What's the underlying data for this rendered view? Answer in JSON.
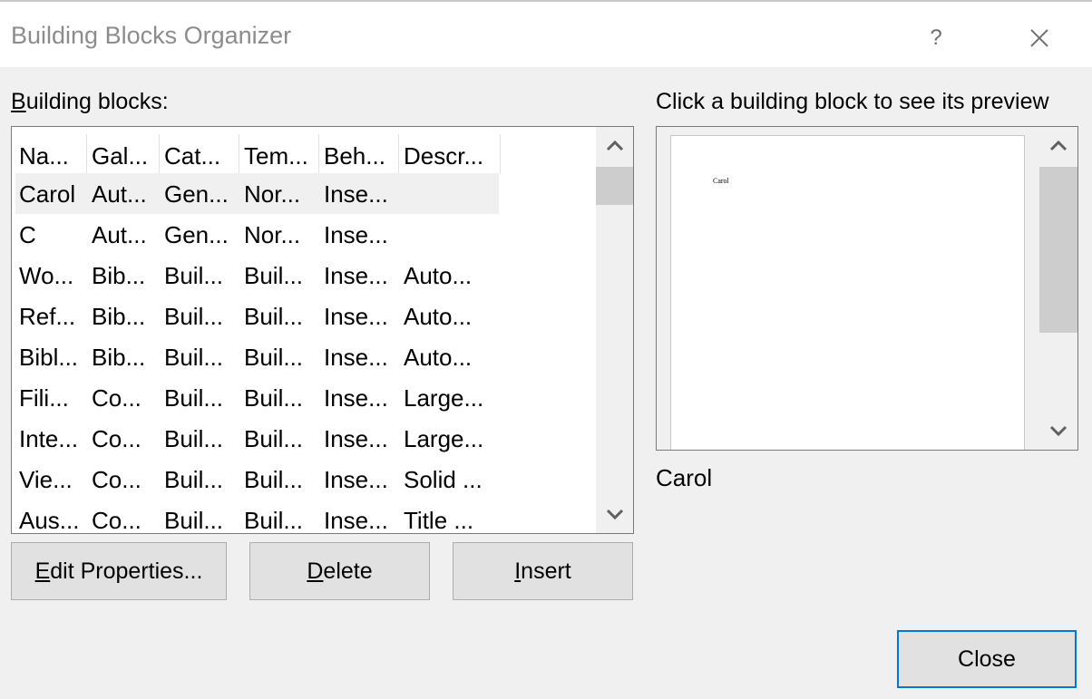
{
  "window": {
    "title": "Building Blocks Organizer",
    "help_label": "?"
  },
  "blocks": {
    "label_prefix": "B",
    "label_rest": "uilding blocks:",
    "columns": [
      "Na...",
      "Gal...",
      "Cat...",
      "Tem...",
      "Beh...",
      "Descr..."
    ],
    "rows": [
      {
        "cells": [
          "Carol",
          "Aut...",
          "Gen...",
          "Nor...",
          "Inse...",
          ""
        ],
        "selected": true
      },
      {
        "cells": [
          "C",
          "Aut...",
          "Gen...",
          "Nor...",
          "Inse...",
          ""
        ]
      },
      {
        "cells": [
          "Wo...",
          "Bib...",
          "Buil...",
          "Buil...",
          "Inse...",
          "Auto..."
        ]
      },
      {
        "cells": [
          "Ref...",
          "Bib...",
          "Buil...",
          "Buil...",
          "Inse...",
          "Auto..."
        ]
      },
      {
        "cells": [
          "Bibl...",
          "Bib...",
          "Buil...",
          "Buil...",
          "Inse...",
          "Auto..."
        ]
      },
      {
        "cells": [
          "Fili...",
          "Co...",
          "Buil...",
          "Buil...",
          "Inse...",
          "Large..."
        ]
      },
      {
        "cells": [
          "Inte...",
          "Co...",
          "Buil...",
          "Buil...",
          "Inse...",
          "Large..."
        ]
      },
      {
        "cells": [
          "Vie...",
          "Co...",
          "Buil...",
          "Buil...",
          "Inse...",
          "Solid ..."
        ]
      },
      {
        "cells": [
          "Aus...",
          "Co...",
          "Buil...",
          "Buil...",
          "Inse...",
          "Title ..."
        ]
      }
    ]
  },
  "buttons": {
    "edit_prefix": "E",
    "edit_rest": "dit Properties...",
    "delete_prefix": "D",
    "delete_rest": "elete",
    "insert_prefix": "I",
    "insert_rest": "nsert",
    "close": "Close"
  },
  "preview": {
    "label": "Click a building block to see its preview",
    "page_text": "Carol",
    "name": "Carol"
  },
  "icons": {
    "close": "close-icon",
    "scroll_up": "chevron-up-icon",
    "scroll_down": "chevron-down-icon"
  },
  "colors": {
    "accent": "#0078d7",
    "button_face": "#e1e1e1",
    "dialog_bg": "#f0f0f0"
  }
}
